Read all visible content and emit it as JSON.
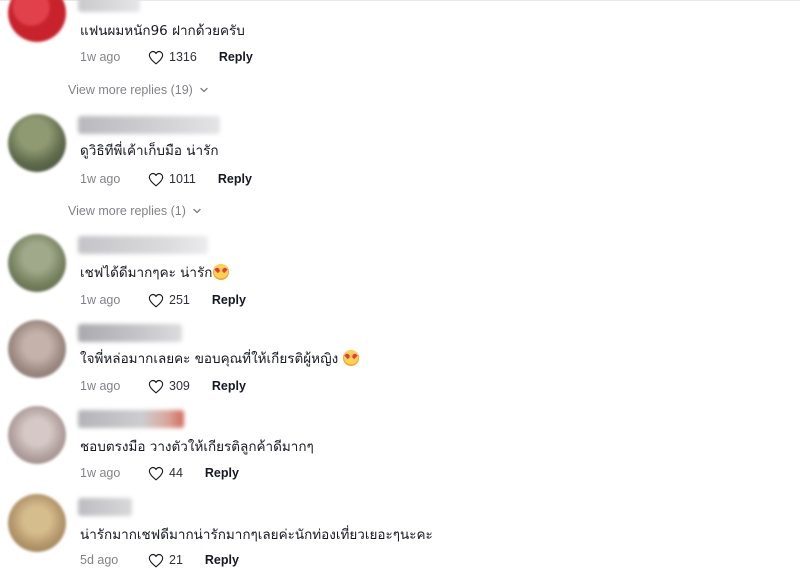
{
  "comments": [
    {
      "text": "แฟนผมหนัก96 ฝากด้วยครับ",
      "time": "1w ago",
      "likes": "1316",
      "reply_label": "Reply",
      "view_more": "View more replies (19)",
      "avatar_color": "#c8232c"
    },
    {
      "text": "ดูวิธิทีพี่เค้าเก็บมือ น่ารัก",
      "time": "1w ago",
      "likes": "1011",
      "reply_label": "Reply",
      "view_more": "View more replies (1)",
      "avatar_color": "#6f7a5c"
    },
    {
      "text": "เชฟได้ดีมากๆคะ น่ารัก",
      "time": "1w ago",
      "likes": "251",
      "reply_label": "Reply",
      "avatar_color": "#7b866a"
    },
    {
      "text": "ใจพี่หล่อมากเลยคะ ขอบคุณที่ให้เกียรติผู้หญิง",
      "time": "1w ago",
      "likes": "309",
      "reply_label": "Reply",
      "avatar_color": "#a8968e"
    },
    {
      "text": "ชอบตรงมือ วางตัวให้เกียรติลูกค้าดีมากๆ",
      "time": "1w ago",
      "likes": "44",
      "reply_label": "Reply",
      "avatar_color": "#b8a8a6"
    },
    {
      "text": "น่ารักมากเชฟดีมากน่ารักมากๆเลยค่ะนักท่องเที่ยวเยอะๆนะคะ",
      "time": "5d ago",
      "likes": "21",
      "reply_label": "Reply",
      "avatar_color": "#b79a6c"
    }
  ],
  "icons": {
    "heart": "heart-outline-icon",
    "chevron": "chevron-down-icon",
    "emoji": "smiling-face-with-hearts-emoji"
  },
  "colors": {
    "text": "#161823",
    "muted": "rgba(22,24,35,0.55)"
  }
}
